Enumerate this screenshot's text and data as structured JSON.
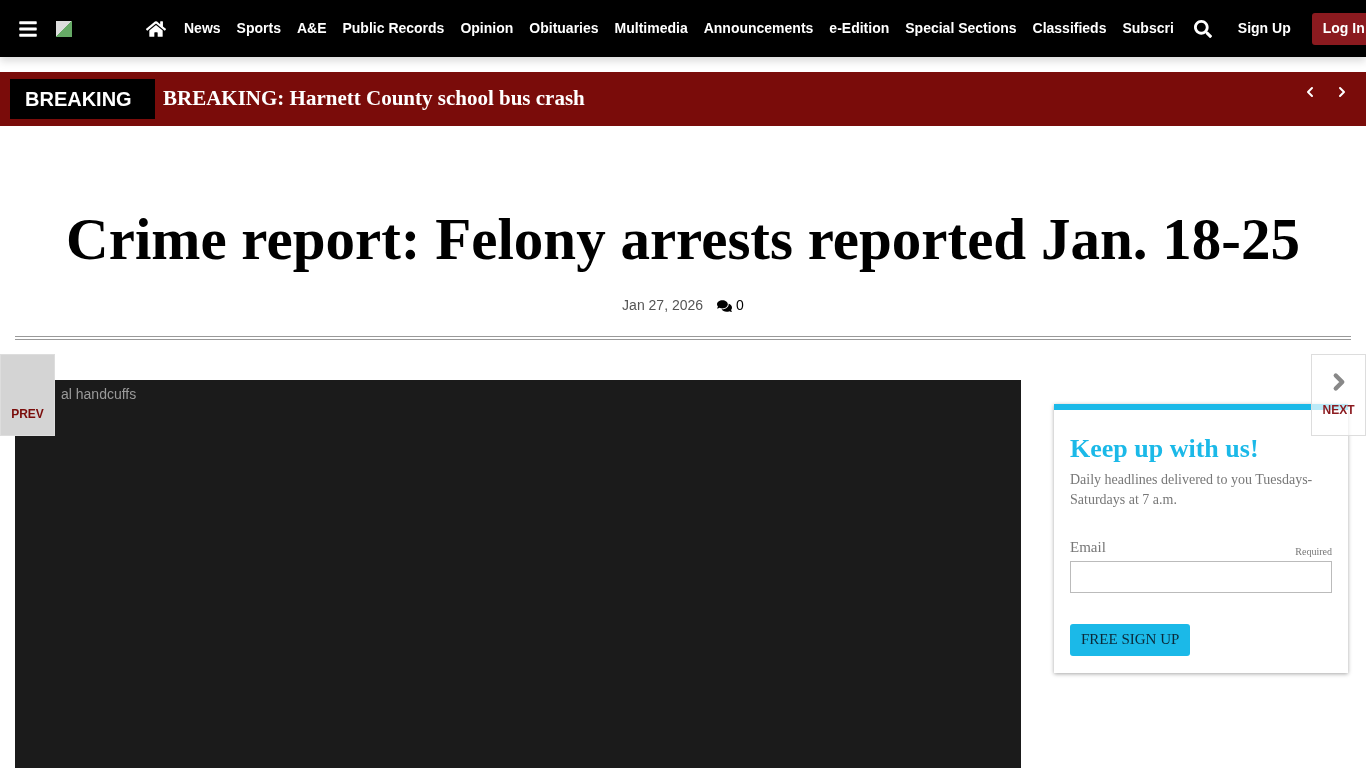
{
  "nav": {
    "items": [
      "News",
      "Sports",
      "A&E",
      "Public Records",
      "Opinion",
      "Obituaries",
      "Multimedia",
      "Announcements",
      "e-Edition",
      "Special Sections",
      "Classifieds",
      "Subscri"
    ],
    "sign_up": "Sign Up",
    "log_in": "Log In"
  },
  "breaking": {
    "label": "BREAKING",
    "headline": "BREAKING: Harnett County school bus crash"
  },
  "article": {
    "title": "Crime report: Felony arrests reported Jan. 18-25",
    "date": "Jan 27, 2026",
    "comments": "0",
    "image_alt": "al handcuffs"
  },
  "pager": {
    "prev": "PREV",
    "next": "NEXT"
  },
  "signup": {
    "title": "Keep up with us!",
    "text": "Daily headlines delivered to you Tuesdays-Saturdays at 7 a.m.",
    "email_label": "Email",
    "required": "Required",
    "button": "FREE SIGN UP"
  }
}
